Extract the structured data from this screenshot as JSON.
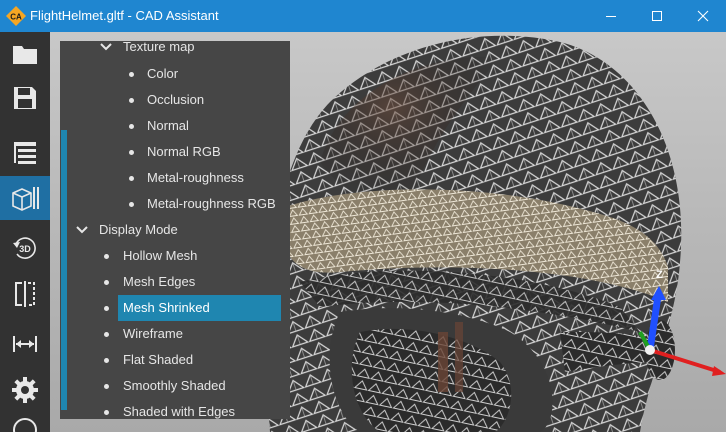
{
  "window": {
    "title": "FlightHelmet.gltf - CAD Assistant",
    "logo_text": "CA"
  },
  "toolbar": {
    "items": [
      {
        "name": "open-folder-icon"
      },
      {
        "name": "save-icon"
      },
      {
        "name": "model-tree-icon"
      },
      {
        "name": "display-settings-icon",
        "active": true
      },
      {
        "name": "3d-view-icon",
        "label": "3D"
      },
      {
        "name": "section-icon"
      },
      {
        "name": "measure-icon"
      },
      {
        "name": "settings-gear-icon"
      }
    ]
  },
  "panel": {
    "texture_map_header": "Texture map",
    "texture_items": [
      "Color",
      "Occlusion",
      "Normal",
      "Normal RGB",
      "Metal-roughness",
      "Metal-roughness RGB"
    ],
    "display_mode_header": "Display Mode",
    "display_items": [
      "Hollow Mesh",
      "Mesh Edges",
      "Mesh Shrinked",
      "Wireframe",
      "Flat Shaded",
      "Smoothly Shaded",
      "Shaded with Edges"
    ],
    "selected": "Mesh Shrinked"
  },
  "axes": {
    "z_label": "Z",
    "colors": {
      "x": "#e02020",
      "y": "#20a020",
      "z": "#2050ff"
    }
  },
  "colors": {
    "titlebar": "#1f86d0",
    "toolbar": "#323232",
    "accent": "#1f86b0",
    "panel": "#464646"
  }
}
